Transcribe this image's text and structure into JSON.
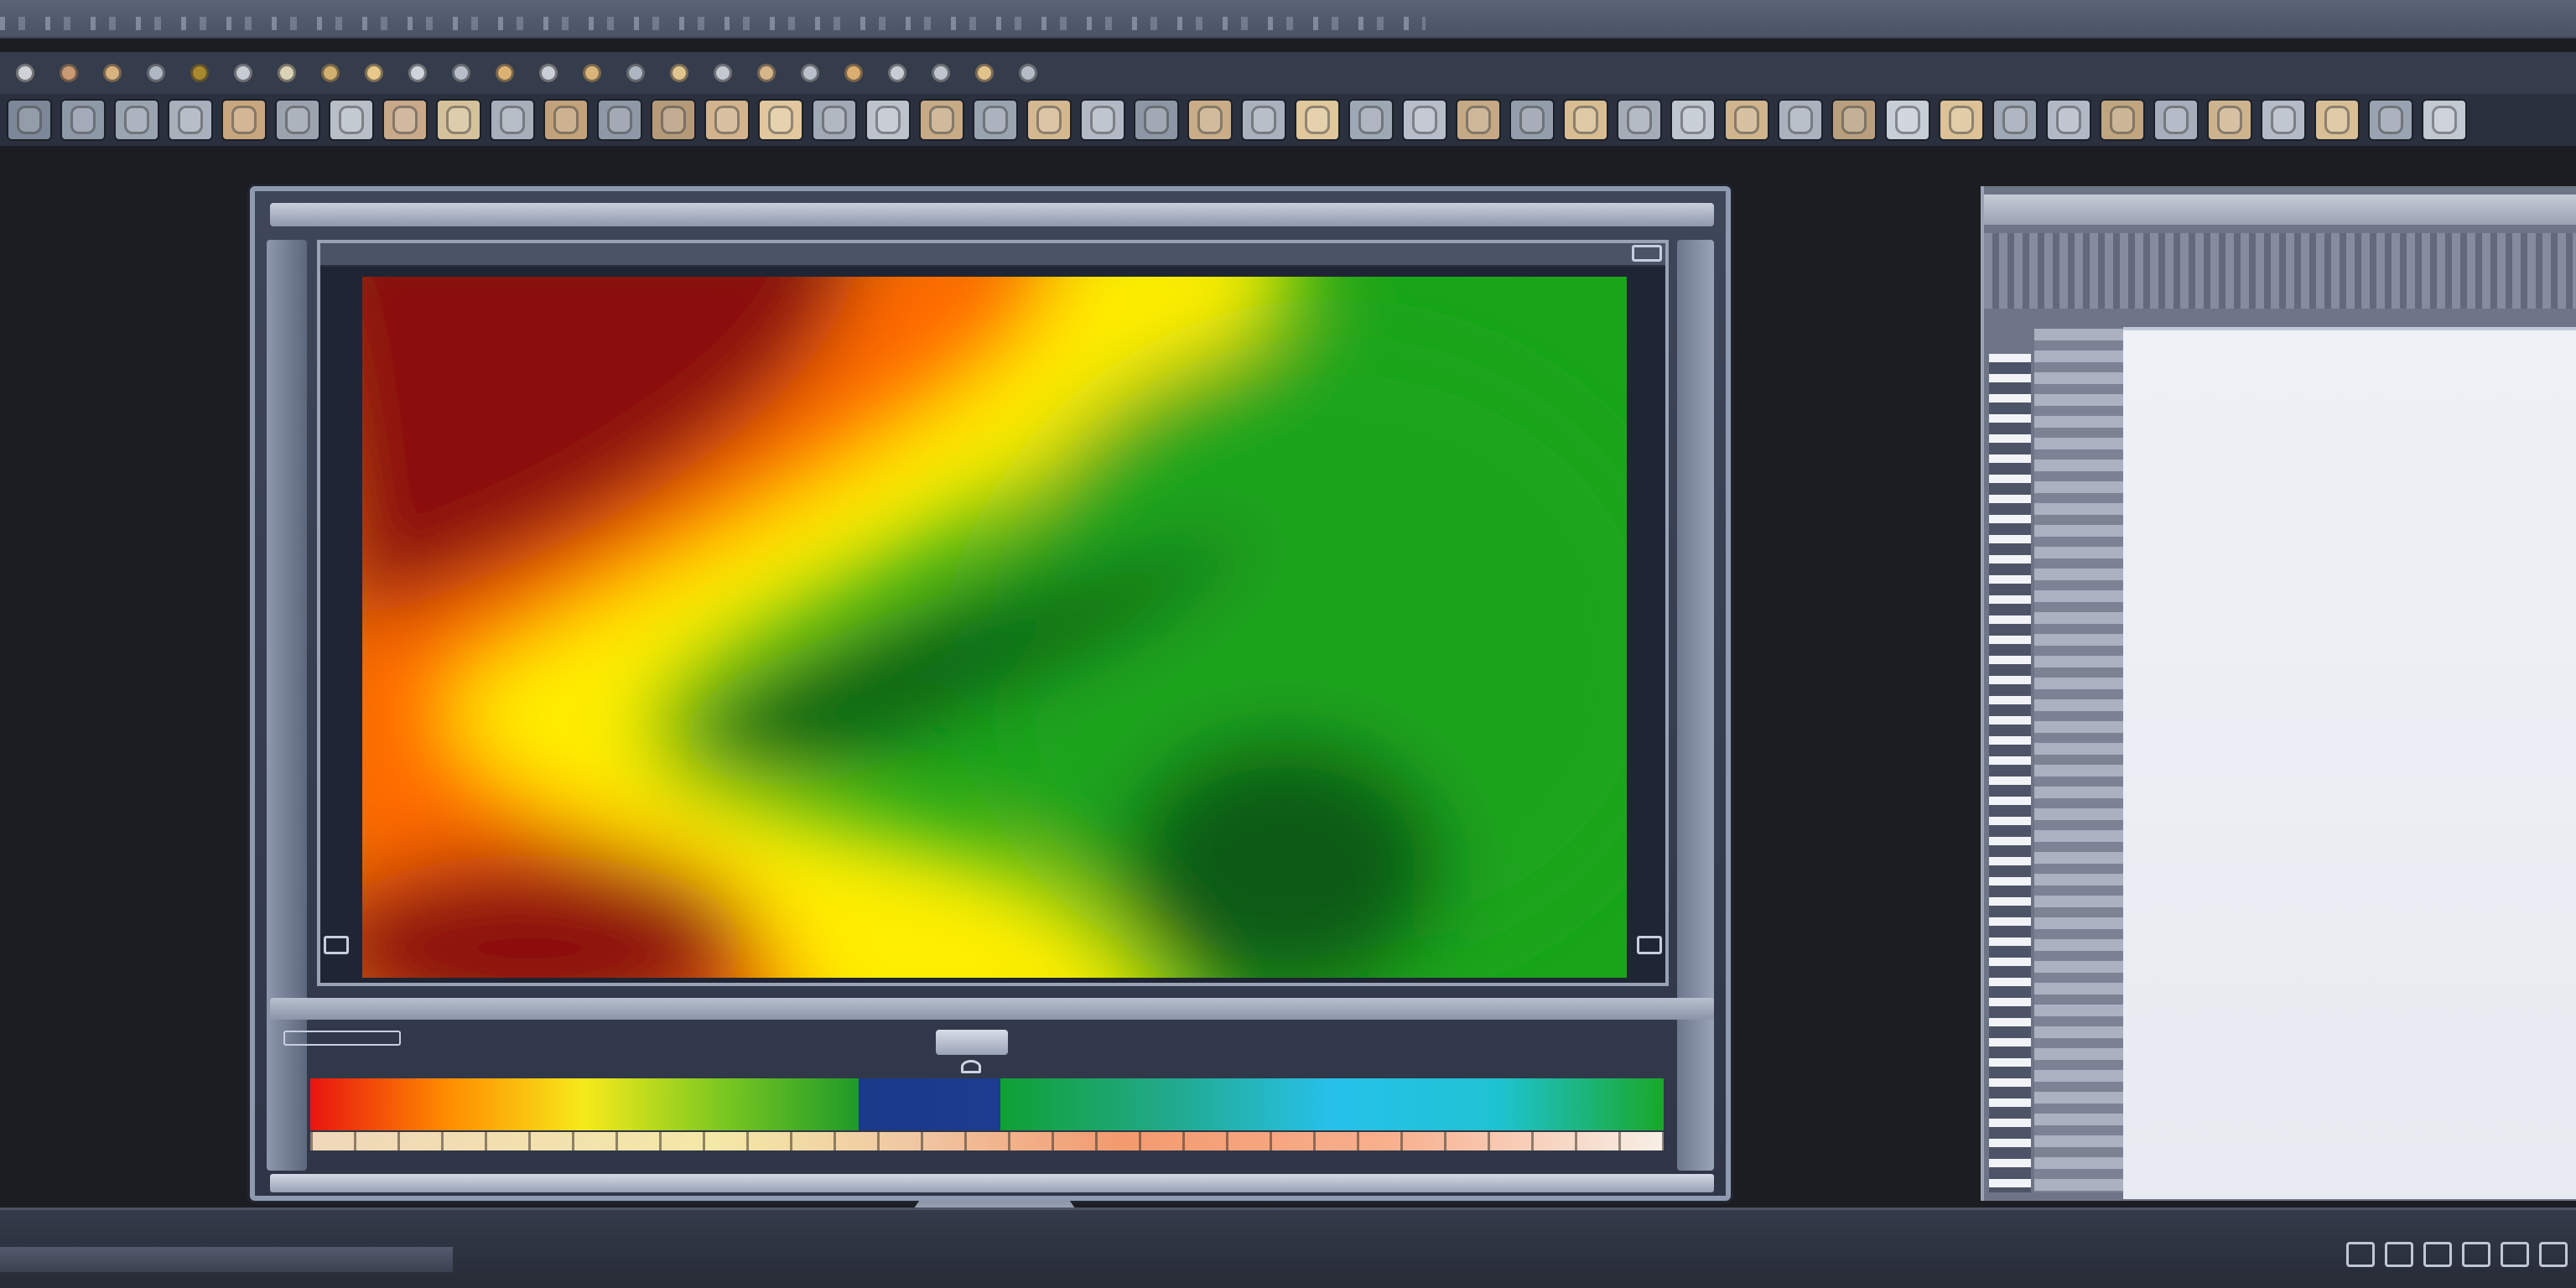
{
  "app": {
    "colors": {
      "chrome": "#4a5366",
      "toolbar": "#2a303d",
      "background": "#1c1d22",
      "document": "#eef1f6"
    }
  },
  "toolbar_top": {
    "buttons": [
      {
        "icon": "brush-icon",
        "color": "#cfd3d9"
      },
      {
        "icon": "eraser-icon",
        "color": "#c99a73"
      },
      {
        "icon": "lasso-icon",
        "color": "#d7b27e"
      },
      {
        "icon": "circle-icon",
        "color": "#b0b7c4"
      },
      {
        "icon": "stamp-icon",
        "color": "#a8892e"
      },
      {
        "icon": "text-icon",
        "color": "#c7cbd3"
      },
      {
        "icon": "zoom-icon",
        "color": "#d9d2b6"
      },
      {
        "icon": "hand-icon",
        "color": "#d2b06d"
      },
      {
        "icon": "crop-icon",
        "color": "#e7c78a"
      },
      {
        "icon": "gradient-icon",
        "color": "#ced3dc"
      },
      {
        "icon": "move-icon",
        "color": "#b7bec9"
      },
      {
        "icon": "blur-icon",
        "color": "#dcb274"
      },
      {
        "icon": "pen-icon",
        "color": "#c9ced6"
      },
      {
        "icon": "fill-icon",
        "color": "#d9b57a"
      },
      {
        "icon": "shape-icon",
        "color": "#aeb5c2"
      },
      {
        "icon": "dropper-icon",
        "color": "#e0c48e"
      },
      {
        "icon": "heal-icon",
        "color": "#c3c8d1"
      },
      {
        "icon": "dodge-icon",
        "color": "#d6b58a"
      },
      {
        "icon": "burn-icon",
        "color": "#b9c0cb"
      },
      {
        "icon": "sponge-icon",
        "color": "#d9ae70"
      },
      {
        "icon": "slice-icon",
        "color": "#c8cdd5"
      },
      {
        "icon": "ruler-icon",
        "color": "#bfc5cf"
      },
      {
        "icon": "note-icon",
        "color": "#e3c38c"
      },
      {
        "icon": "count-icon",
        "color": "#b5bcc8"
      }
    ]
  },
  "toolbar_thumbs": {
    "buttons": [
      {
        "icon": "texture-icon",
        "color": "#7c8797"
      },
      {
        "icon": "texture-icon",
        "color": "#8e99a8"
      },
      {
        "icon": "texture-icon",
        "color": "#9aa4b1"
      },
      {
        "icon": "texture-icon",
        "color": "#a7b0bb"
      },
      {
        "icon": "pattern-icon",
        "color": "#c9a77e"
      },
      {
        "icon": "pattern-icon",
        "color": "#9ba3ae"
      },
      {
        "icon": "pattern-icon",
        "color": "#b8bfc8"
      },
      {
        "icon": "pattern-icon",
        "color": "#c8a98a"
      },
      {
        "icon": "pattern-icon",
        "color": "#d6c29a"
      },
      {
        "icon": "pattern-icon",
        "color": "#a7afbb"
      },
      {
        "icon": "pattern-icon",
        "color": "#c2a27a"
      },
      {
        "icon": "pattern-icon",
        "color": "#8f98a6"
      },
      {
        "icon": "pattern-icon",
        "color": "#b59a7a"
      },
      {
        "icon": "pattern-icon",
        "color": "#d2b38e"
      },
      {
        "icon": "pattern-icon",
        "color": "#e1c89e"
      },
      {
        "icon": "pattern-icon",
        "color": "#a1a9b5"
      },
      {
        "icon": "pattern-icon",
        "color": "#bcc3cd"
      },
      {
        "icon": "pattern-icon",
        "color": "#c6ab86"
      },
      {
        "icon": "pattern-icon",
        "color": "#9aa3b0"
      },
      {
        "icon": "pattern-icon",
        "color": "#d4b990"
      },
      {
        "icon": "pattern-icon",
        "color": "#b3bac5"
      },
      {
        "icon": "pattern-icon",
        "color": "#8d96a4"
      },
      {
        "icon": "pattern-icon",
        "color": "#c9ad88"
      },
      {
        "icon": "pattern-icon",
        "color": "#a9b1bd"
      },
      {
        "icon": "pattern-icon",
        "color": "#e0c79c"
      },
      {
        "icon": "pattern-icon",
        "color": "#9ea7b4"
      },
      {
        "icon": "pattern-icon",
        "color": "#b7beca"
      },
      {
        "icon": "pattern-icon",
        "color": "#c4a984"
      },
      {
        "icon": "pattern-icon",
        "color": "#949dab"
      },
      {
        "icon": "pattern-icon",
        "color": "#d8bd93"
      },
      {
        "icon": "pattern-icon",
        "color": "#a4acb8"
      },
      {
        "icon": "pattern-icon",
        "color": "#bfc6d0"
      },
      {
        "icon": "pattern-icon",
        "color": "#cfb48c"
      },
      {
        "icon": "pattern-icon",
        "color": "#aab2be"
      },
      {
        "icon": "pattern-icon",
        "color": "#b8a07e"
      },
      {
        "icon": "pattern-icon",
        "color": "#c8ced8"
      },
      {
        "icon": "pattern-icon",
        "color": "#dcc296"
      },
      {
        "icon": "pattern-icon",
        "color": "#9fa8b5"
      },
      {
        "icon": "pattern-icon",
        "color": "#b2b9c5"
      },
      {
        "icon": "pattern-icon",
        "color": "#c0a680"
      },
      {
        "icon": "pattern-icon",
        "color": "#a6aebb"
      },
      {
        "icon": "pattern-icon",
        "color": "#cdb48e"
      },
      {
        "icon": "pattern-icon",
        "color": "#b4bbc6"
      },
      {
        "icon": "pattern-icon",
        "color": "#d9bf95"
      },
      {
        "icon": "pattern-icon",
        "color": "#9aa3b1"
      },
      {
        "icon": "pattern-icon",
        "color": "#c3c9d3"
      }
    ]
  },
  "heatmap": {
    "colors": {
      "hot": "#8b0f0f",
      "warm": "#ff6a00",
      "mid": "#ffee00",
      "cool": "#1aa51a",
      "cold": "#0c5a15"
    }
  },
  "legend": {
    "segments": [
      {
        "color_stops": [
          "#e8150f",
          "#ff8c00",
          "#f6ea1a",
          "#7bc820",
          "#1e9a28"
        ],
        "width": 0.405
      },
      {
        "color_stops": [
          "#1a3a8a",
          "#1b3c90"
        ],
        "width": 0.105
      },
      {
        "color_stops": [
          "#0fa133",
          "#21a98a",
          "#27c1ea",
          "#1ec3d2",
          "#19a829"
        ],
        "width": 0.49
      }
    ]
  },
  "status_bar": {
    "icons": [
      "layers-icon",
      "history-icon",
      "info-icon",
      "navigator-icon",
      "settings-icon",
      "help-icon"
    ]
  }
}
